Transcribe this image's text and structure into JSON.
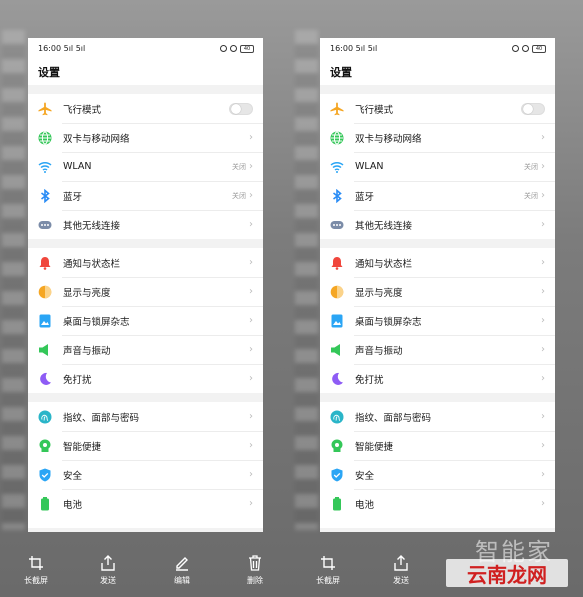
{
  "statusbar": {
    "time": "16:00",
    "signal": "5ıl 5ıl",
    "battery": "40"
  },
  "page_title": "设置",
  "groups": [
    [
      {
        "label": "飞行模式",
        "type": "toggle",
        "icon": "airplane-icon",
        "color": "#f5a623"
      },
      {
        "label": "双卡与移动网络",
        "type": "chevron",
        "icon": "globe-icon",
        "color": "#34c759"
      },
      {
        "label": "WLAN",
        "value": "关闭",
        "type": "chevron",
        "icon": "wifi-icon",
        "color": "#2aa5f5"
      },
      {
        "label": "蓝牙",
        "value": "关闭",
        "type": "chevron",
        "icon": "bluetooth-icon",
        "color": "#2a8cf5"
      },
      {
        "label": "其他无线连接",
        "type": "chevron",
        "icon": "more-connections-icon",
        "color": "#7b8ca8"
      }
    ],
    [
      {
        "label": "通知与状态栏",
        "type": "chevron",
        "icon": "bell-icon",
        "color": "#f0463c"
      },
      {
        "label": "显示与亮度",
        "type": "chevron",
        "icon": "brightness-icon",
        "color": "#f5a623"
      },
      {
        "label": "桌面与锁屏杂志",
        "type": "chevron",
        "icon": "wallpaper-icon",
        "color": "#2aa5f5"
      },
      {
        "label": "声音与振动",
        "type": "chevron",
        "icon": "speaker-icon",
        "color": "#34c759"
      },
      {
        "label": "免打扰",
        "type": "chevron",
        "icon": "moon-icon",
        "color": "#8e5cf5"
      }
    ],
    [
      {
        "label": "指纹、面部与密码",
        "type": "chevron",
        "icon": "fingerprint-icon",
        "color": "#2ab5c8"
      },
      {
        "label": "智能便捷",
        "type": "chevron",
        "icon": "smart-icon",
        "color": "#34c759"
      },
      {
        "label": "安全",
        "type": "chevron",
        "icon": "shield-icon",
        "color": "#2aa5f5"
      },
      {
        "label": "电池",
        "type": "chevron",
        "icon": "battery-icon",
        "color": "#34c759"
      }
    ]
  ],
  "chevron": "›",
  "toolbar": [
    {
      "label": "长截屏",
      "icon": "crop-icon"
    },
    {
      "label": "发送",
      "icon": "share-icon"
    },
    {
      "label": "编辑",
      "icon": "edit-icon"
    },
    {
      "label": "删除",
      "icon": "trash-icon"
    }
  ],
  "watermark": {
    "top": "智能家",
    "main": "云南龙网"
  }
}
